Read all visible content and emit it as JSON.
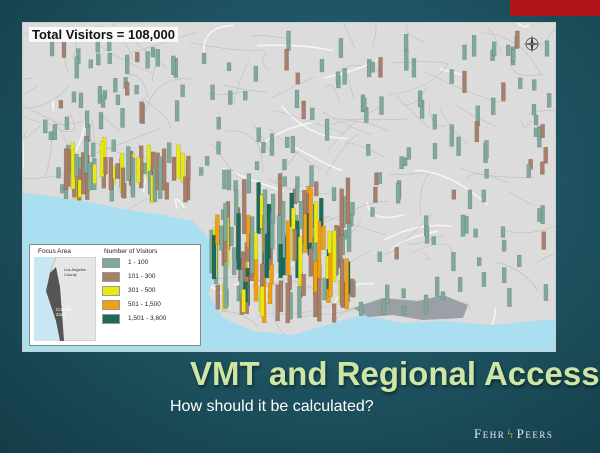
{
  "slide": {
    "title": "VMT and Regional Access",
    "subtitle": "How should it be calculated?",
    "logo_left": "Fehr",
    "logo_right": "Peers",
    "accent_color": "#b3141b",
    "title_color": "#cde6a6"
  },
  "map": {
    "title": "Total Visitors = 108,000",
    "north_arrow_icon": "compass-rose-icon",
    "legend": {
      "focus_area_header": "Focus Area",
      "visitors_header": "Number of Visitors",
      "inset_labels": [
        "Los Angeles County",
        "Coastal Zone"
      ],
      "items": [
        {
          "label": "1 - 100",
          "color": "#7fa99a"
        },
        {
          "label": "101 - 300",
          "color": "#a87f6a"
        },
        {
          "label": "301 - 500",
          "color": "#e8e817"
        },
        {
          "label": "501 - 1,500",
          "color": "#f0a012"
        },
        {
          "label": "1,501 - 3,600",
          "color": "#1e6b5a"
        }
      ]
    }
  }
}
